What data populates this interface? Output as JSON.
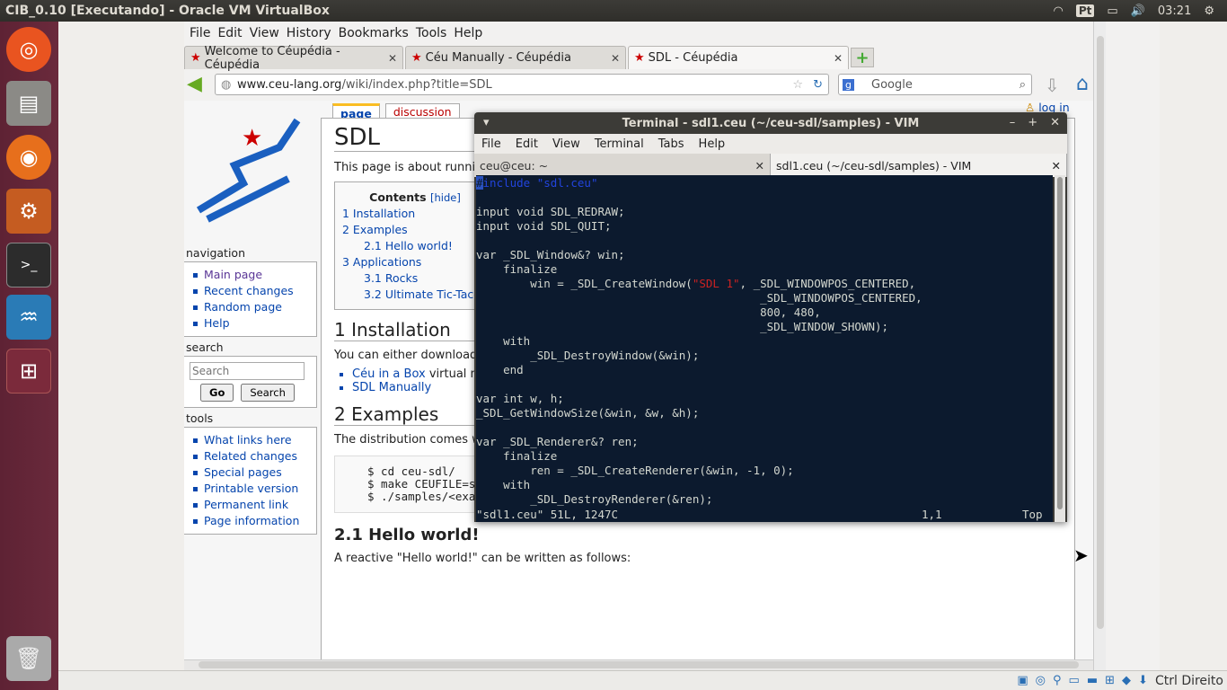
{
  "window_title": "CIB_0.10 [Executando] - Oracle VM VirtualBox",
  "topbar": {
    "keyboard": "Pt",
    "clock": "03:21"
  },
  "firefox": {
    "menu": [
      "File",
      "Edit",
      "View",
      "History",
      "Bookmarks",
      "Tools",
      "Help"
    ],
    "tabs": [
      {
        "label": "Welcome to Céupédia - Céupédia"
      },
      {
        "label": "Céu Manually - Céupédia"
      },
      {
        "label": "SDL - Céupédia"
      }
    ],
    "url_host": "www.ceu-lang.org",
    "url_path": "/wiki/index.php?title=SDL",
    "search_placeholder": "Google"
  },
  "wiki": {
    "login": "log in",
    "tab_page": "page",
    "tab_discussion": "discussion",
    "title": "SDL",
    "intro": "This page is about runni",
    "toc_title": "Contents",
    "toc_hide": "[hide]",
    "toc": [
      "1 Installation",
      "2 Examples",
      "2.1 Hello world!",
      "3 Applications",
      "3.1 Rocks",
      "3.2 Ultimate Tic-Tac-T"
    ],
    "h_install": "1 Installation",
    "install_text": "You can either download",
    "install_links": [
      "Céu in a Box",
      "SDL Manually"
    ],
    "install_link_suffix": " virtual m",
    "h_examples": "2 Examples",
    "examples_text": "The distribution comes w",
    "code": "$ cd ceu-sdl/\n$ make CEUFILE=samples/<example.ceu>\n$ ./samples/<example.exe>",
    "h_hello": "2.1 Hello world!",
    "hello_text": "A reactive \"Hello world!\" can be written as follows:",
    "nav_title": "navigation",
    "nav": [
      "Main page",
      "Recent changes",
      "Random page",
      "Help"
    ],
    "search_title": "search",
    "search_placeholder": "Search",
    "go_label": "Go",
    "search_btn": "Search",
    "tools_title": "tools",
    "tools": [
      "What links here",
      "Related changes",
      "Special pages",
      "Printable version",
      "Permanent link",
      "Page information"
    ]
  },
  "terminal": {
    "title": "Terminal - sdl1.ceu (~/ceu-sdl/samples) - VIM",
    "menu": [
      "File",
      "Edit",
      "View",
      "Terminal",
      "Tabs",
      "Help"
    ],
    "tabs": [
      "ceu@ceu: ~",
      "sdl1.ceu (~/ceu-sdl/samples) - VIM"
    ],
    "status_file": "\"sdl1.ceu\" 51L, 1247C",
    "status_pos": "1,1",
    "status_top": "Top"
  },
  "vbox_status": {
    "host_key": "Ctrl Direito"
  }
}
